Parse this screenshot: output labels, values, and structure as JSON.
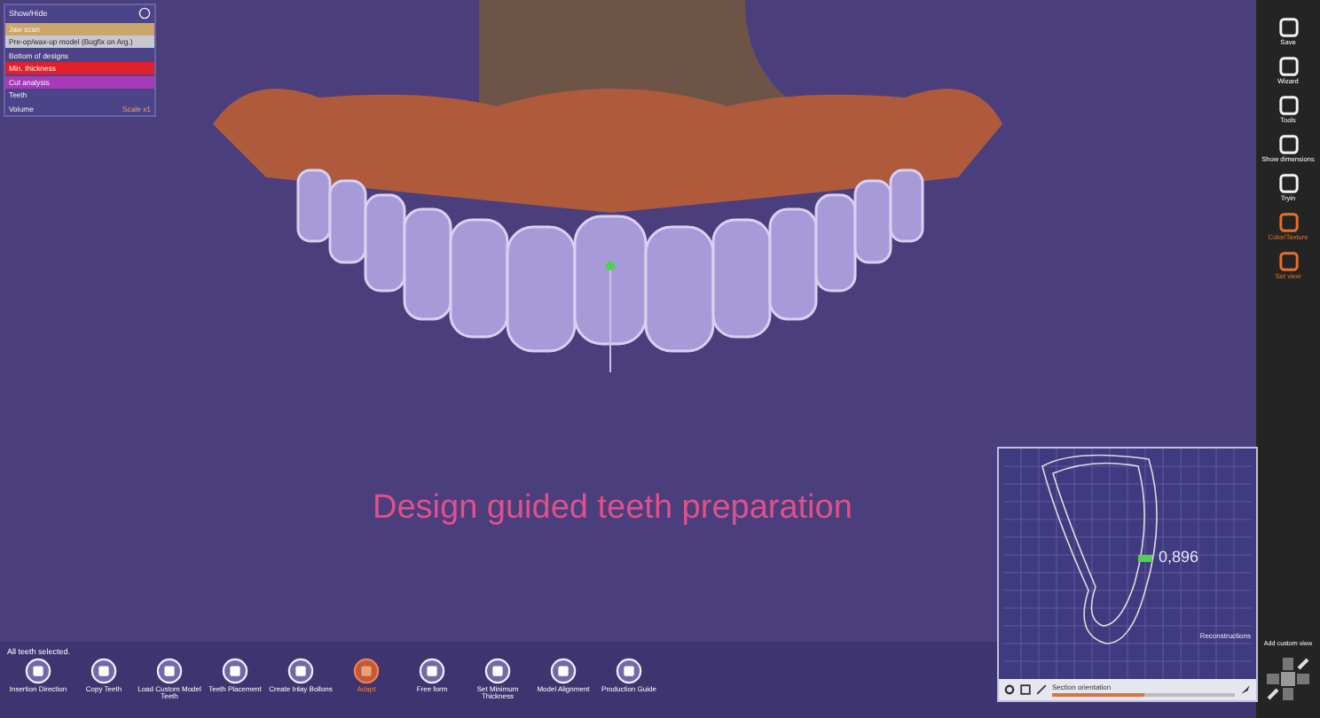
{
  "layers_panel": {
    "title": "Show/Hide",
    "items": [
      {
        "label": "Jaw scan",
        "color": "#c9a66b"
      },
      {
        "label": "Pre-op/wax-up model (Bugfix on Arg.)",
        "color": "#c8c8d0"
      },
      {
        "label": "Bottom of designs"
      },
      {
        "label": "Min. thickness",
        "color": "#e0202a"
      },
      {
        "label": "Cut analysis",
        "color": "#a83ab8"
      },
      {
        "label": "Teeth"
      },
      {
        "label": "Volume",
        "value": "Scale x1"
      }
    ]
  },
  "caption": "Design guided teeth preparation",
  "section_view": {
    "measurement": "0,896",
    "slider_label": "Section orientation",
    "level": 0.5,
    "footer": "Reconstructions"
  },
  "bottom_toolbar": {
    "status": "All teeth selected.",
    "tools": [
      {
        "label": "Insertion Direction",
        "selected": false
      },
      {
        "label": "Copy Teeth",
        "selected": false
      },
      {
        "label": "Load Custom Model Teeth",
        "selected": false
      },
      {
        "label": "Teeth Placement",
        "selected": false
      },
      {
        "label": "Create Inlay Bollons",
        "selected": false
      },
      {
        "label": "Adapt",
        "selected": true
      },
      {
        "label": "Free form",
        "selected": false
      },
      {
        "label": "Set Minimum Thickness",
        "selected": false
      },
      {
        "label": "Model Alignment",
        "selected": false
      },
      {
        "label": "Production Guide",
        "selected": false
      }
    ]
  },
  "side_toolbar": {
    "tools": [
      {
        "label": "Save",
        "active": false
      },
      {
        "label": "Wizard",
        "active": false
      },
      {
        "label": "Tools",
        "active": false
      },
      {
        "label": "Show dimensions",
        "active": false
      },
      {
        "label": "Tryin",
        "active": false
      },
      {
        "label": "Color/Texture",
        "active": true
      },
      {
        "label": "Set view",
        "active": true
      }
    ],
    "view_label": "Add custom view"
  }
}
